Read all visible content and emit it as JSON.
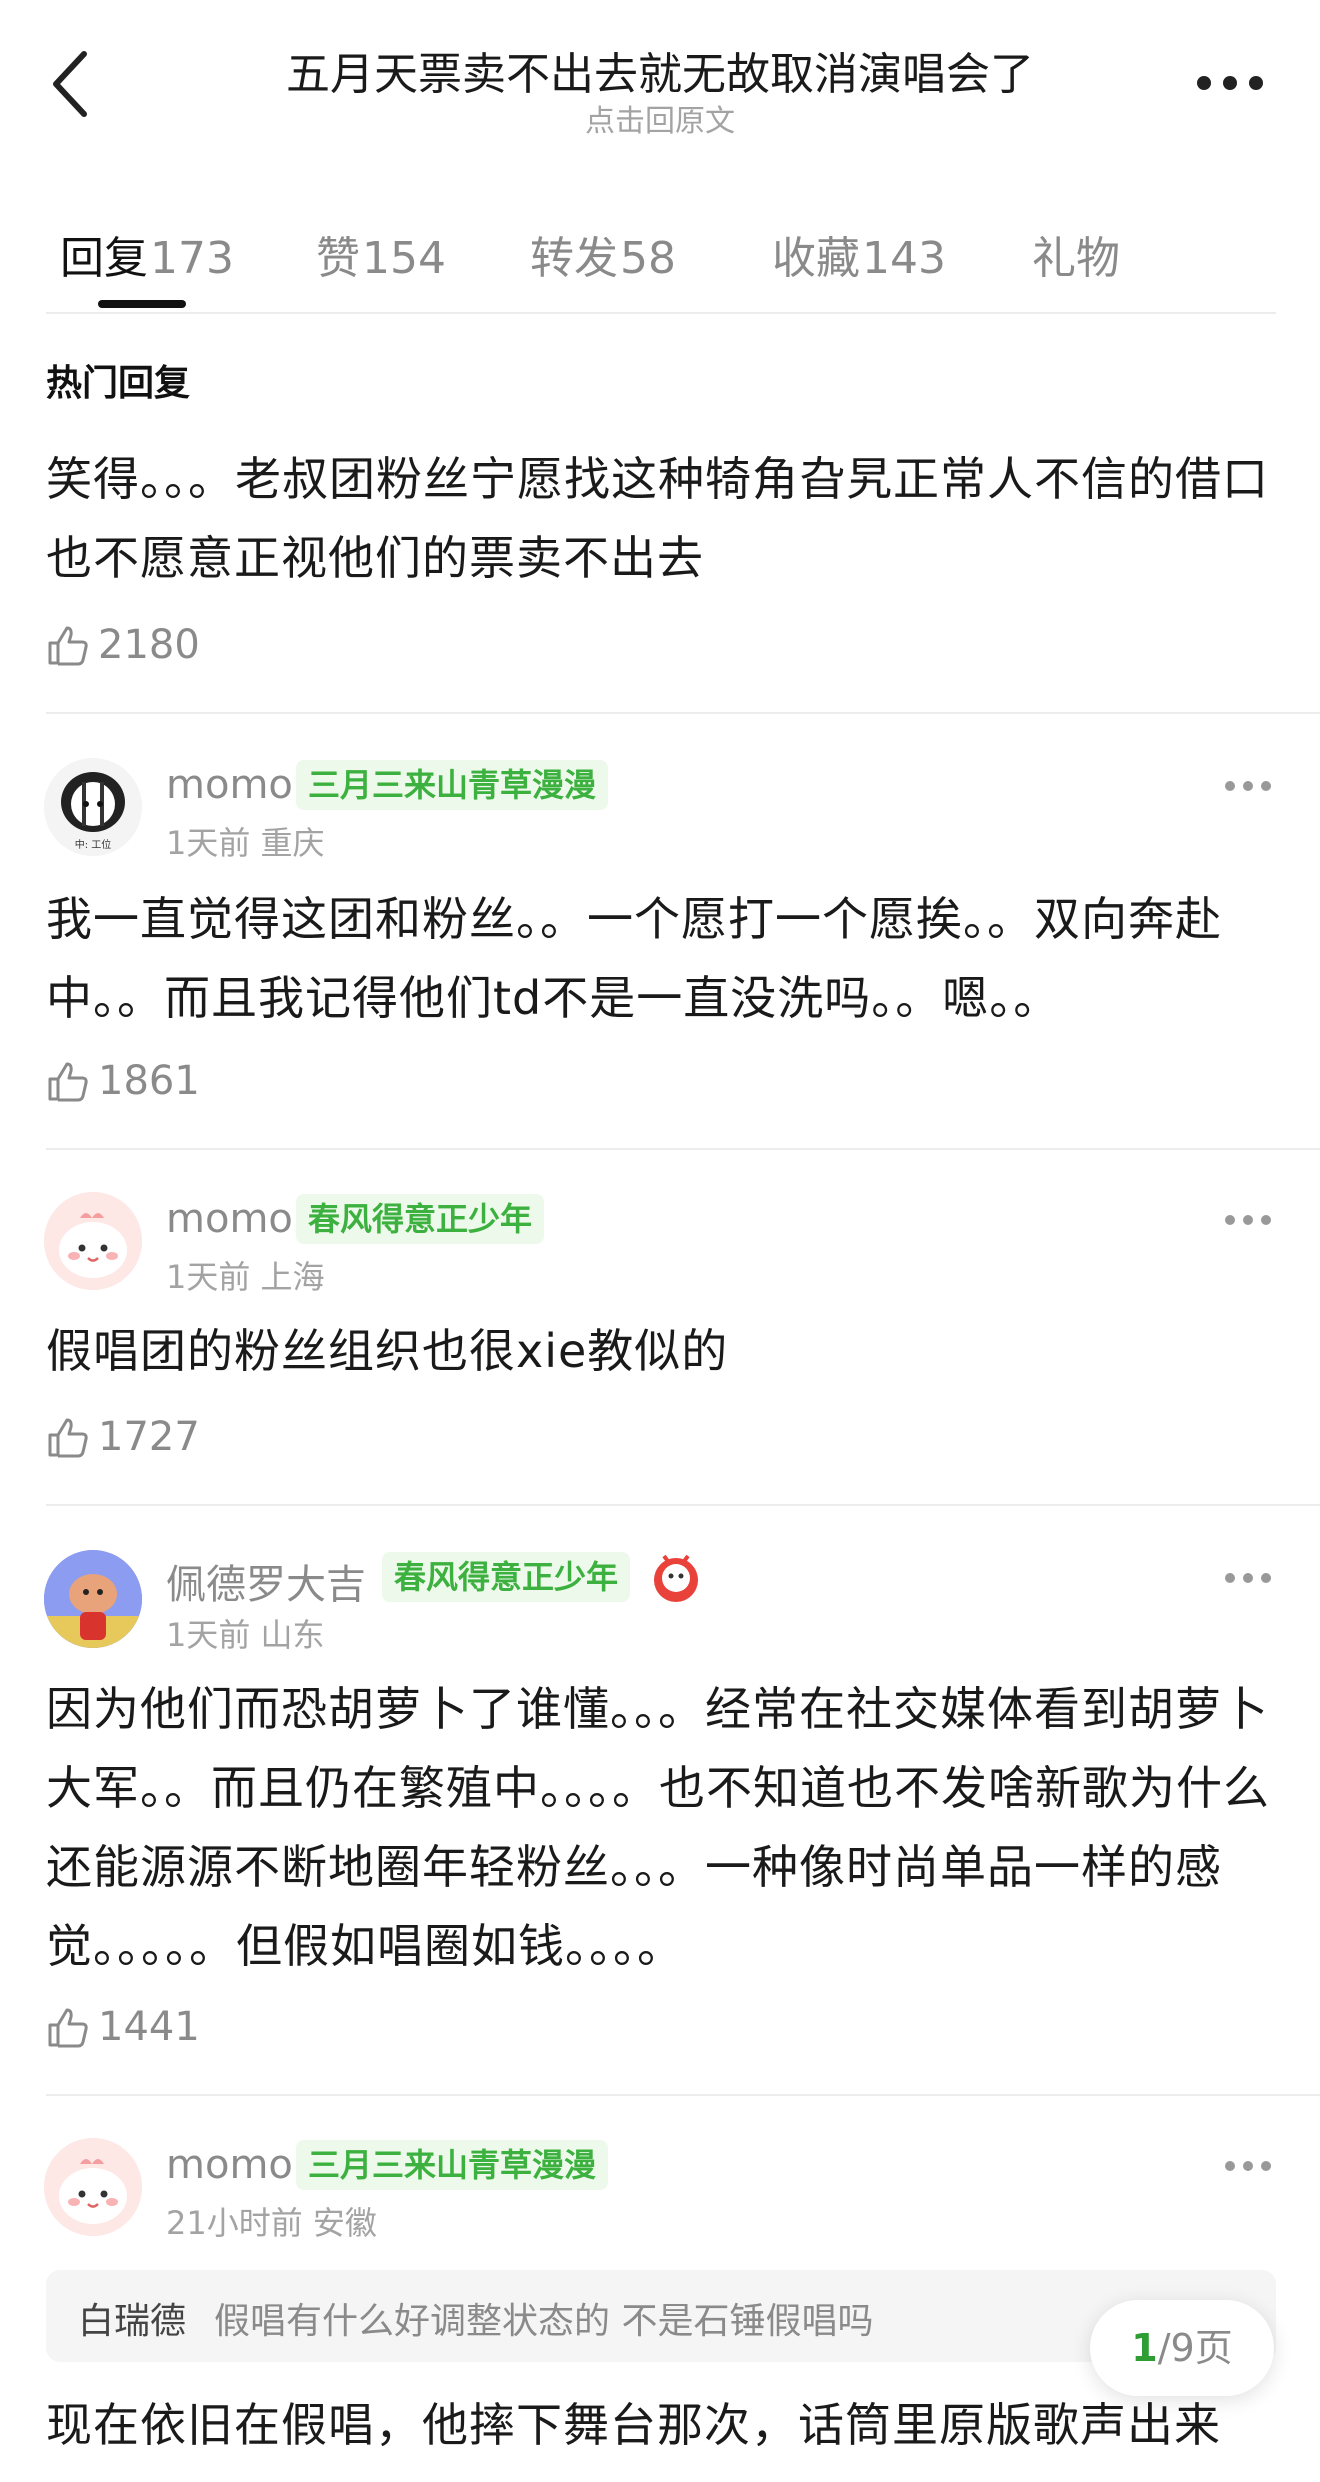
{
  "header": {
    "title": "五月天票卖不出去就无故取消演唱会了",
    "subtitle": "点击回原文"
  },
  "tabs": [
    {
      "label": "回复",
      "count": "173",
      "active": true
    },
    {
      "label": "赞",
      "count": "154"
    },
    {
      "label": "转发",
      "count": "58"
    },
    {
      "label": "收藏",
      "count": "143"
    },
    {
      "label": "礼物",
      "count": ""
    }
  ],
  "section_title": "热门回复",
  "top_comment": {
    "text": "笑得。。。老叔团粉丝宁愿找这种犄角旮旯正常人不信的借口也不愿意正视他们的票卖不出去",
    "likes": "2180"
  },
  "comments": [
    {
      "name": "momo",
      "badge": "三月三来山青草漫漫",
      "meta": "1天前 重庆",
      "text": "我一直觉得这团和粉丝。。一个愿打一个愿挨。。双向奔赴中。。而且我记得他们td不是一直没洗吗。。嗯。。",
      "likes": "1861",
      "avatar_caption": "中: 工位"
    },
    {
      "name": "momo",
      "badge": "春风得意正少年",
      "meta": "1天前 上海",
      "text": "假唱团的粉丝组织也很xie教似的",
      "likes": "1727"
    },
    {
      "name": "佩德罗大吉",
      "badge": "春风得意正少年",
      "meta": "1天前 山东",
      "text": "因为他们而恐胡萝卜了谁懂。。。经常在社交媒体看到胡萝卜大军。。而且仍在繁殖中。。。。也不知道也不发啥新歌为什么还能源源不断地圈年轻粉丝。。。一种像时尚单品一样的感觉。。。。。但假如唱圈如钱。。。。",
      "likes": "1441"
    },
    {
      "name": "momo",
      "badge": "三月三来山青草漫漫",
      "meta": "21小时前 安徽",
      "quote_name": "白瑞德",
      "quote_text": "假唱有什么好调整状态的 不是石锤假唱吗",
      "text": "现在依旧在假唱，他摔下舞台那次，话筒里原版歌声出来"
    }
  ],
  "pager": {
    "current": "1",
    "rest": "/9页"
  },
  "colors": {
    "badge_green": "#3cb13f",
    "badge_bg": "#edf9ea",
    "muted": "#8a8a8a"
  }
}
